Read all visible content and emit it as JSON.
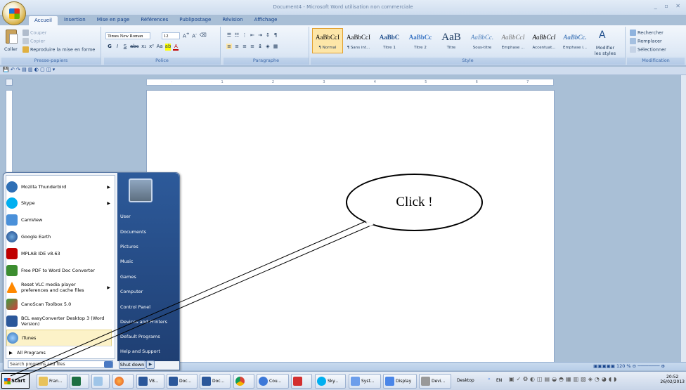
{
  "window": {
    "title": "Document4 - Microsoft Word utilisation non commerciale"
  },
  "ribbon": {
    "tabs": [
      "Accueil",
      "Insertion",
      "Mise en page",
      "Références",
      "Publipostage",
      "Révision",
      "Affichage"
    ],
    "clipboard": {
      "paste": "Coller",
      "cut": "Couper",
      "copy": "Copier",
      "format_painter": "Reproduire la mise en forme",
      "group": "Presse-papiers"
    },
    "font": {
      "name": "Times New Roman",
      "size": "12",
      "group": "Police"
    },
    "paragraph": {
      "group": "Paragraphe"
    },
    "styles": {
      "group": "Style",
      "items": [
        {
          "sample": "AaBbCcI",
          "name": "¶ Normal"
        },
        {
          "sample": "AaBbCcI",
          "name": "¶ Sans int..."
        },
        {
          "sample": "AaBbC",
          "name": "Titre 1"
        },
        {
          "sample": "AaBbCc",
          "name": "Titre 2"
        },
        {
          "sample": "AaB",
          "name": "Titre"
        },
        {
          "sample": "AaBbCc.",
          "name": "Sous-titre"
        },
        {
          "sample": "AaBbCcI",
          "name": "Emphase ..."
        },
        {
          "sample": "AaBbCcI",
          "name": "Accentuat..."
        },
        {
          "sample": "AaBbCc.",
          "name": "Emphase i..."
        }
      ],
      "change_styles": "Modifier les styles"
    },
    "editing": {
      "find": "Rechercher",
      "replace": "Remplacer",
      "select": "Sélectionner",
      "group": "Modification"
    }
  },
  "status": {
    "zoom": "120 %"
  },
  "start_menu": {
    "programs": [
      {
        "label": "Mozilla Thunderbird",
        "arrow": "▶"
      },
      {
        "label": "Skype",
        "arrow": "▶"
      },
      {
        "label": "CamView",
        "arrow": ""
      },
      {
        "label": "Google Earth",
        "arrow": ""
      },
      {
        "label": "MPLAB IDE v8.63",
        "arrow": ""
      },
      {
        "label": "Free PDF to Word Doc Converter",
        "arrow": ""
      },
      {
        "label": "Reset VLC media player preferences and cache files",
        "arrow": "▶"
      },
      {
        "label": "CanoScan Toolbox 5.0",
        "arrow": ""
      },
      {
        "label": "BCL easyConverter Desktop 3 (Word Version)",
        "arrow": ""
      },
      {
        "label": "iTunes",
        "arrow": ""
      }
    ],
    "all_programs": "All Programs",
    "search_placeholder": "Search programs and files",
    "right_items": [
      "User",
      "Documents",
      "Pictures",
      "Music",
      "Games",
      "Computer",
      "Control Panel",
      "Devices and Printers",
      "Default Programs",
      "Help and Support"
    ],
    "shutdown": "Shut down"
  },
  "taskbar": {
    "start": "Start",
    "buttons": [
      {
        "label": "Fran..."
      },
      {
        "label": ""
      },
      {
        "label": ""
      },
      {
        "label": ""
      },
      {
        "label": "V8..."
      },
      {
        "label": "Doc..."
      },
      {
        "label": "Doc..."
      },
      {
        "label": ""
      },
      {
        "label": "Cou..."
      },
      {
        "label": ""
      },
      {
        "label": "Sky..."
      },
      {
        "label": "Syst..."
      },
      {
        "label": "Display"
      },
      {
        "label": "Devi..."
      }
    ],
    "desktop": "Desktop",
    "lang": "EN",
    "time": "20:52",
    "date": "26/02/2013"
  },
  "annotation": {
    "text": "Click !"
  },
  "colors": {
    "accent": "#e1a030",
    "start_menu_right": "#2d5a9a"
  }
}
